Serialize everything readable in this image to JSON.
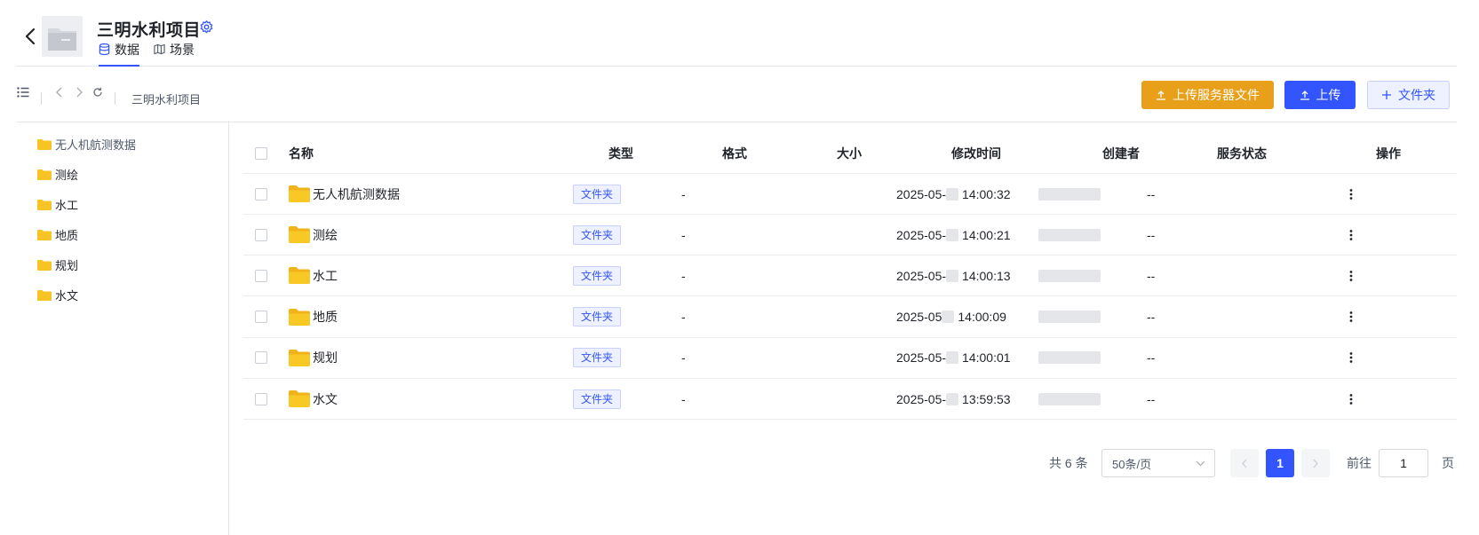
{
  "header": {
    "project_title": "三明水利项目",
    "tabs": [
      {
        "label": "数据",
        "active": true
      },
      {
        "label": "场景",
        "active": false
      }
    ]
  },
  "toolbar": {
    "breadcrumb": "三明水利项目",
    "buttons": {
      "upload_server": "上传服务器文件",
      "upload": "上传",
      "new_folder": "文件夹"
    }
  },
  "sidebar": {
    "items": [
      "无人机航测数据",
      "测绘",
      "水工",
      "地质",
      "规划",
      "水文"
    ]
  },
  "table": {
    "columns": [
      "名称",
      "类型",
      "格式",
      "大小",
      "修改时间",
      "创建者",
      "服务状态",
      "操作"
    ],
    "rows": [
      {
        "name": "无人机航测数据",
        "type": "文件夹",
        "format": "-",
        "size": "",
        "date_prefix": "2025-05-",
        "time": "14:00:32",
        "creator": "",
        "status": "--"
      },
      {
        "name": "测绘",
        "type": "文件夹",
        "format": "-",
        "size": "",
        "date_prefix": "2025-05-",
        "time": "14:00:21",
        "creator": "",
        "status": "--"
      },
      {
        "name": "水工",
        "type": "文件夹",
        "format": "-",
        "size": "",
        "date_prefix": "2025-05-",
        "time": "14:00:13",
        "creator": "",
        "status": "--"
      },
      {
        "name": "地质",
        "type": "文件夹",
        "format": "-",
        "size": "",
        "date_prefix": "2025-05",
        "time": "14:00:09",
        "creator": "",
        "status": "--"
      },
      {
        "name": "规划",
        "type": "文件夹",
        "format": "-",
        "size": "",
        "date_prefix": "2025-05-",
        "time": "14:00:01",
        "creator": "",
        "status": "--"
      },
      {
        "name": "水文",
        "type": "文件夹",
        "format": "-",
        "size": "",
        "date_prefix": "2025-05-",
        "time": "13:59:53",
        "creator": "",
        "status": "--"
      }
    ]
  },
  "pagination": {
    "total_text": "共 6 条",
    "page_size": "50条/页",
    "current_page": "1",
    "goto_label": "前往",
    "goto_value": "1",
    "page_suffix": "页"
  },
  "colors": {
    "accent": "#3355ff",
    "server_button": "#e8a01b",
    "folder": "#f7c325"
  }
}
